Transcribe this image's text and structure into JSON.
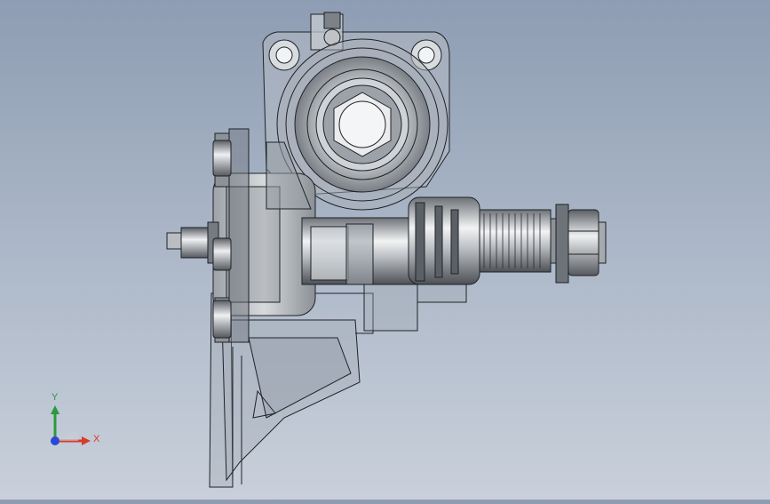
{
  "viewport": {
    "description": "",
    "triad": {
      "x_label": "X",
      "y_label": "Y"
    },
    "colors": {
      "bg_top": "#8e9db3",
      "bg_bottom": "#c9d0db",
      "metal_light": "#e8eaec",
      "metal_dark": "#4a4e54",
      "edge": "#1e2226",
      "axis_x": "#d93a2a",
      "axis_y": "#2a9a3a",
      "axis_z": "#2a48d8"
    }
  }
}
